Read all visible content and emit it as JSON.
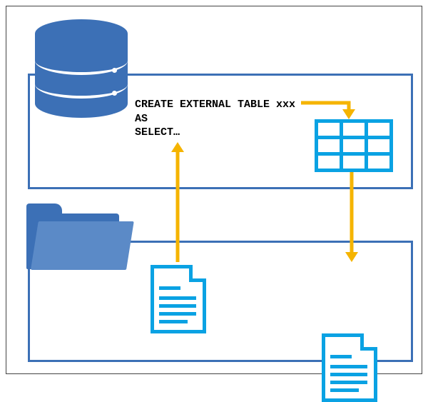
{
  "sql": {
    "line1": "CREATE EXTERNAL TABLE xxx",
    "line2": "AS",
    "line3": "SELECT…"
  },
  "labels": {
    "database_icon": "database-icon",
    "folder_icon": "folder-icon",
    "table_icon": "table-icon",
    "source_file_icon": "source-file-icon",
    "output_file_icon": "output-file-icon"
  },
  "colors": {
    "blue_dark": "#3c70b6",
    "blue_light": "#0aa2e3",
    "arrow": "#f5b400"
  }
}
